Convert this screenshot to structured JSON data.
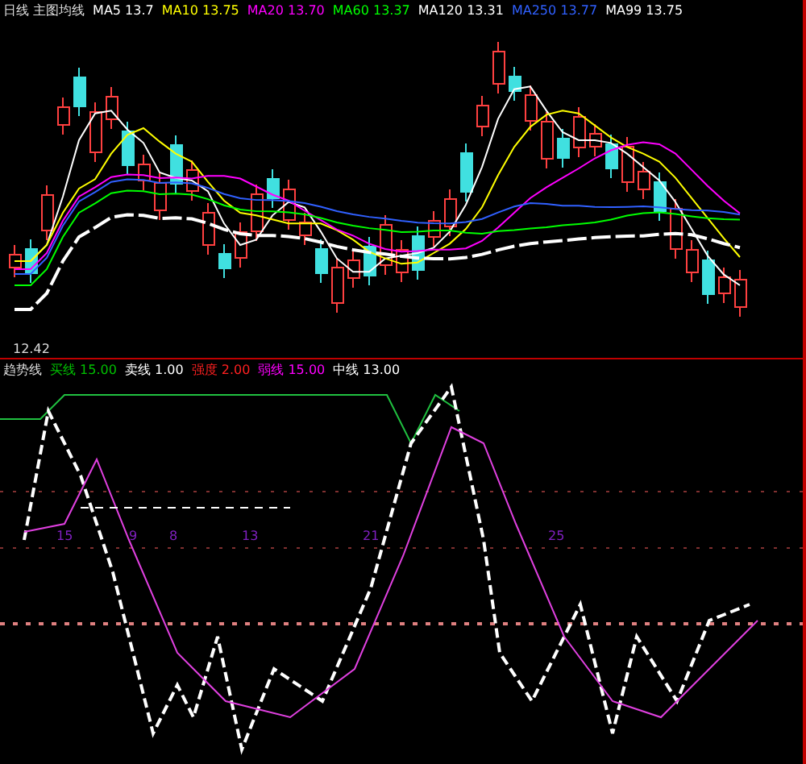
{
  "main_chart": {
    "legend": [
      {
        "text": "MA5 13.7",
        "color": "#ffffff"
      },
      {
        "text": "MA10 13.75",
        "color": "#ffff00"
      },
      {
        "text": "MA20 13.70",
        "color": "#ff00ff"
      },
      {
        "text": "MA60 13.37",
        "color": "#00ff00"
      },
      {
        "text": "MA120 13.31",
        "color": "#ffffff"
      },
      {
        "text": "MA250 13.77",
        "color": "#3060ff"
      },
      {
        "text": "MA99 13.75",
        "color": "#ffffff"
      }
    ],
    "title": "日线 主图均线",
    "low_label": "12.42"
  },
  "indicator": {
    "title": "趋势线",
    "legend": [
      {
        "text": "买线 15.00",
        "color": "#00c000"
      },
      {
        "text": "卖线 1.00",
        "color": "#ffffff"
      },
      {
        "text": "强度 2.00",
        "color": "#ff2020"
      },
      {
        "text": "弱线 15.00",
        "color": "#ff00ff"
      },
      {
        "text": "中线 13.00",
        "color": "#ffffff"
      }
    ],
    "markers": [
      "15",
      "9",
      "8",
      "13",
      "21",
      "25"
    ]
  }
}
